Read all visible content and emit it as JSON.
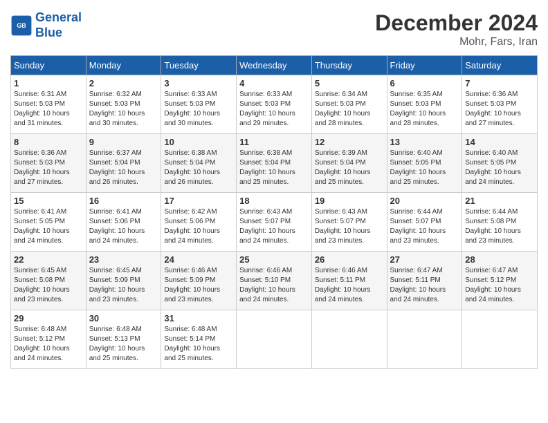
{
  "header": {
    "logo_line1": "General",
    "logo_line2": "Blue",
    "month_title": "December 2024",
    "location": "Mohr, Fars, Iran"
  },
  "weekdays": [
    "Sunday",
    "Monday",
    "Tuesday",
    "Wednesday",
    "Thursday",
    "Friday",
    "Saturday"
  ],
  "weeks": [
    [
      {
        "day": "1",
        "sunrise": "6:31 AM",
        "sunset": "5:03 PM",
        "daylight": "10 hours and 31 minutes."
      },
      {
        "day": "2",
        "sunrise": "6:32 AM",
        "sunset": "5:03 PM",
        "daylight": "10 hours and 30 minutes."
      },
      {
        "day": "3",
        "sunrise": "6:33 AM",
        "sunset": "5:03 PM",
        "daylight": "10 hours and 30 minutes."
      },
      {
        "day": "4",
        "sunrise": "6:33 AM",
        "sunset": "5:03 PM",
        "daylight": "10 hours and 29 minutes."
      },
      {
        "day": "5",
        "sunrise": "6:34 AM",
        "sunset": "5:03 PM",
        "daylight": "10 hours and 28 minutes."
      },
      {
        "day": "6",
        "sunrise": "6:35 AM",
        "sunset": "5:03 PM",
        "daylight": "10 hours and 28 minutes."
      },
      {
        "day": "7",
        "sunrise": "6:36 AM",
        "sunset": "5:03 PM",
        "daylight": "10 hours and 27 minutes."
      }
    ],
    [
      {
        "day": "8",
        "sunrise": "6:36 AM",
        "sunset": "5:03 PM",
        "daylight": "10 hours and 27 minutes."
      },
      {
        "day": "9",
        "sunrise": "6:37 AM",
        "sunset": "5:04 PM",
        "daylight": "10 hours and 26 minutes."
      },
      {
        "day": "10",
        "sunrise": "6:38 AM",
        "sunset": "5:04 PM",
        "daylight": "10 hours and 26 minutes."
      },
      {
        "day": "11",
        "sunrise": "6:38 AM",
        "sunset": "5:04 PM",
        "daylight": "10 hours and 25 minutes."
      },
      {
        "day": "12",
        "sunrise": "6:39 AM",
        "sunset": "5:04 PM",
        "daylight": "10 hours and 25 minutes."
      },
      {
        "day": "13",
        "sunrise": "6:40 AM",
        "sunset": "5:05 PM",
        "daylight": "10 hours and 25 minutes."
      },
      {
        "day": "14",
        "sunrise": "6:40 AM",
        "sunset": "5:05 PM",
        "daylight": "10 hours and 24 minutes."
      }
    ],
    [
      {
        "day": "15",
        "sunrise": "6:41 AM",
        "sunset": "5:05 PM",
        "daylight": "10 hours and 24 minutes."
      },
      {
        "day": "16",
        "sunrise": "6:41 AM",
        "sunset": "5:06 PM",
        "daylight": "10 hours and 24 minutes."
      },
      {
        "day": "17",
        "sunrise": "6:42 AM",
        "sunset": "5:06 PM",
        "daylight": "10 hours and 24 minutes."
      },
      {
        "day": "18",
        "sunrise": "6:43 AM",
        "sunset": "5:07 PM",
        "daylight": "10 hours and 24 minutes."
      },
      {
        "day": "19",
        "sunrise": "6:43 AM",
        "sunset": "5:07 PM",
        "daylight": "10 hours and 23 minutes."
      },
      {
        "day": "20",
        "sunrise": "6:44 AM",
        "sunset": "5:07 PM",
        "daylight": "10 hours and 23 minutes."
      },
      {
        "day": "21",
        "sunrise": "6:44 AM",
        "sunset": "5:08 PM",
        "daylight": "10 hours and 23 minutes."
      }
    ],
    [
      {
        "day": "22",
        "sunrise": "6:45 AM",
        "sunset": "5:08 PM",
        "daylight": "10 hours and 23 minutes."
      },
      {
        "day": "23",
        "sunrise": "6:45 AM",
        "sunset": "5:09 PM",
        "daylight": "10 hours and 23 minutes."
      },
      {
        "day": "24",
        "sunrise": "6:46 AM",
        "sunset": "5:09 PM",
        "daylight": "10 hours and 23 minutes."
      },
      {
        "day": "25",
        "sunrise": "6:46 AM",
        "sunset": "5:10 PM",
        "daylight": "10 hours and 24 minutes."
      },
      {
        "day": "26",
        "sunrise": "6:46 AM",
        "sunset": "5:11 PM",
        "daylight": "10 hours and 24 minutes."
      },
      {
        "day": "27",
        "sunrise": "6:47 AM",
        "sunset": "5:11 PM",
        "daylight": "10 hours and 24 minutes."
      },
      {
        "day": "28",
        "sunrise": "6:47 AM",
        "sunset": "5:12 PM",
        "daylight": "10 hours and 24 minutes."
      }
    ],
    [
      {
        "day": "29",
        "sunrise": "6:48 AM",
        "sunset": "5:12 PM",
        "daylight": "10 hours and 24 minutes."
      },
      {
        "day": "30",
        "sunrise": "6:48 AM",
        "sunset": "5:13 PM",
        "daylight": "10 hours and 25 minutes."
      },
      {
        "day": "31",
        "sunrise": "6:48 AM",
        "sunset": "5:14 PM",
        "daylight": "10 hours and 25 minutes."
      },
      null,
      null,
      null,
      null
    ]
  ]
}
